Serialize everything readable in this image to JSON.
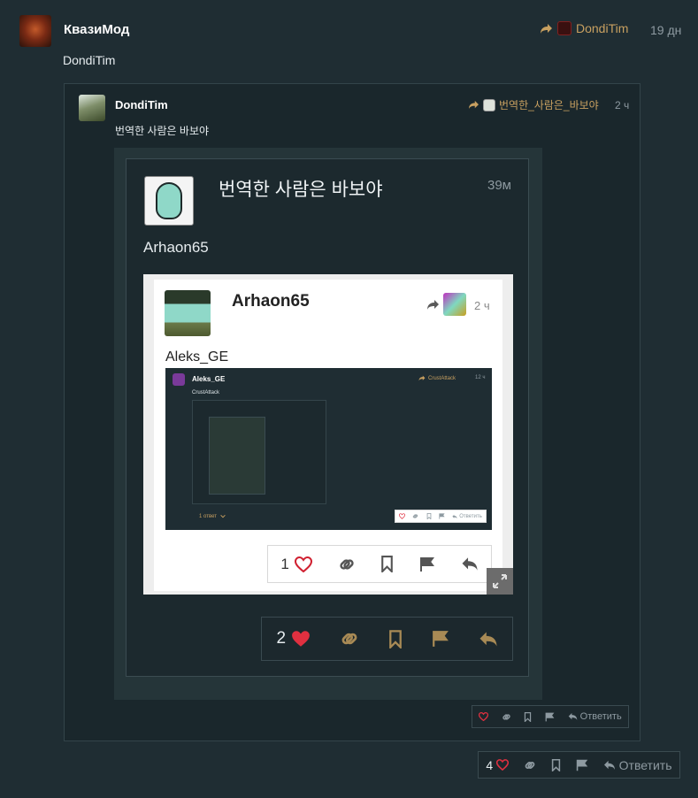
{
  "outer_post": {
    "author": "КвазиМод",
    "reply_to_user": "DondiTim",
    "time_ago": "19 дн",
    "body": "DondiTim",
    "actions": {
      "like_count": "4",
      "reply_label": "Ответить"
    }
  },
  "level1": {
    "author": "DondiTim",
    "reply_to_user": "번역한_사람은_바보야",
    "time_ago": "2 ч",
    "body": "번역한 사람은 바보야",
    "actions": {
      "reply_label": "Ответить"
    }
  },
  "level2": {
    "author": "번역한 사람은 바보야",
    "time_ago": "39м",
    "body": "Arhaon65",
    "actions": {
      "like_count": "2"
    }
  },
  "level3": {
    "author": "Arhaon65",
    "time_ago": "2 ч",
    "body": "Aleks_GE",
    "actions": {
      "like_count": "1"
    }
  },
  "level4": {
    "author": "Aleks_GE",
    "reply_to_user": "CrustAttack",
    "time_ago": "12 ч",
    "body": "CrustAttack",
    "replies_label": "1 ответ",
    "reply_label": "Ответить"
  },
  "colors": {
    "background": "#1f2d33",
    "accent_gold": "#c8a060",
    "like_red": "#e03040"
  }
}
